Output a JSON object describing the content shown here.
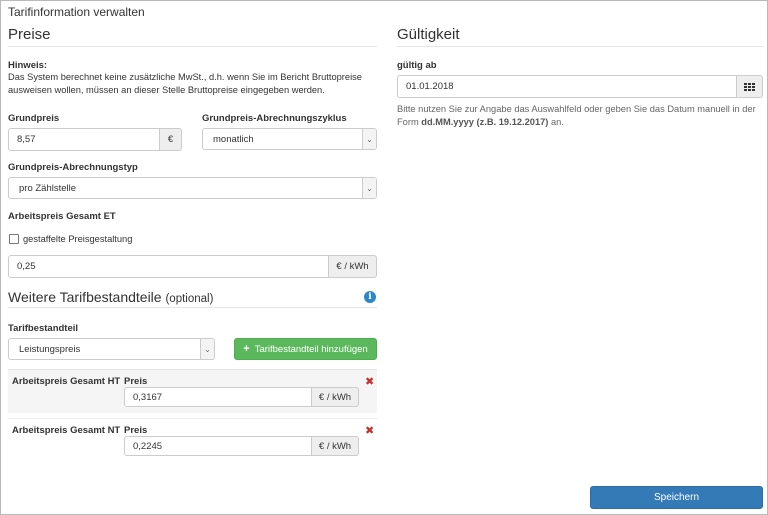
{
  "window": {
    "title": "Tarifinformation verwalten"
  },
  "preise": {
    "heading": "Preise",
    "hint_label": "Hinweis:",
    "hint_text_1": "Das System berechnet keine zusätzliche MwSt., d.h. wenn Sie im Bericht Bruttopreise",
    "hint_text_2": "ausweisen wollen, müssen an dieser Stelle Bruttopreise eingegeben werden.",
    "grundpreis_label": "Grundpreis",
    "grundpreis_value": "8,57",
    "grundpreis_unit": "€",
    "zyklus_label": "Grundpreis-Abrechnungszyklus",
    "zyklus_value": "monatlich",
    "typ_label": "Grundpreis-Abrechnungstyp",
    "typ_value": "pro Zählstelle",
    "arbeitspreis_label": "Arbeitspreis Gesamt ET",
    "gestaffelt_label": "gestaffelte Preisgestaltung",
    "arbeitspreis_value": "0,25",
    "arbeitspreis_unit": "€ / kWh"
  },
  "weitere": {
    "heading": "Weitere Tarifbestandteile",
    "heading_suffix": "(optional)",
    "info_icon": "info-icon",
    "bestandteil_label": "Tarifbestandteil",
    "bestandteil_value": "Leistungspreis",
    "add_button": "Tarifbestandteil hinzufügen",
    "add_icon": "+",
    "rows": [
      {
        "name": "Arbeitspreis Gesamt HT",
        "preis_label": "Preis",
        "value": "0,3167",
        "unit": "€ / kWh"
      },
      {
        "name": "Arbeitspreis Gesamt NT",
        "preis_label": "Preis",
        "value": "0,2245",
        "unit": "€ / kWh"
      }
    ],
    "remove_icon": "✖"
  },
  "gueltigkeit": {
    "heading": "Gültigkeit",
    "label": "gültig ab",
    "date_value": "01.01.2018",
    "help_text_1": "Bitte nutzen Sie zur Angabe das Auswahlfeld oder geben Sie das Datum manuell in der",
    "help_text_2_prefix": "Form ",
    "help_text_2_bold": "dd.MM.yyyy (z.B. 19.12.2017)",
    "help_text_2_suffix": " an."
  },
  "footer": {
    "save_button": "Speichern"
  },
  "colors": {
    "primary": "#337ab7",
    "success": "#5cb85c",
    "danger": "#c9302c",
    "info": "#2a87c8"
  }
}
